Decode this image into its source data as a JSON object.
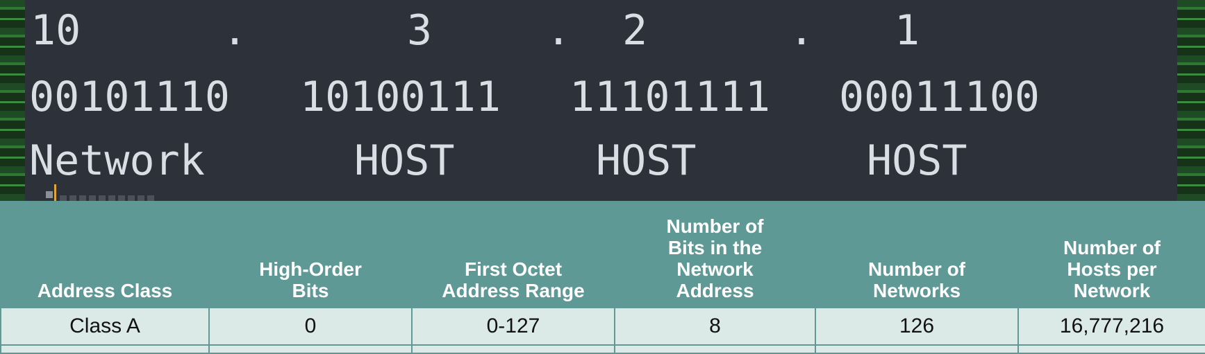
{
  "terminal": {
    "decimal": [
      "10",
      ".",
      "3",
      ".",
      "2",
      ".",
      "1"
    ],
    "binary": [
      "00101110",
      "10100111",
      "11101111",
      "00011100"
    ],
    "roles": [
      "Network",
      "HOST",
      "HOST",
      "HOST"
    ]
  },
  "table": {
    "headers": [
      "Address Class",
      "High-Order\nBits",
      "First Octet\nAddress Range",
      "Number of\nBits in the\nNetwork\nAddress",
      "Number of\nNetworks",
      "Number of\nHosts per\nNetwork"
    ],
    "rows": [
      [
        "Class A",
        "0",
        "0-127",
        "8",
        "126",
        "16,777,216"
      ]
    ]
  },
  "colors": {
    "editor_bg": "#2c313a",
    "editor_text": "#d9dde4",
    "table_header": "#5f9995",
    "table_cell": "#dbe9e7"
  }
}
